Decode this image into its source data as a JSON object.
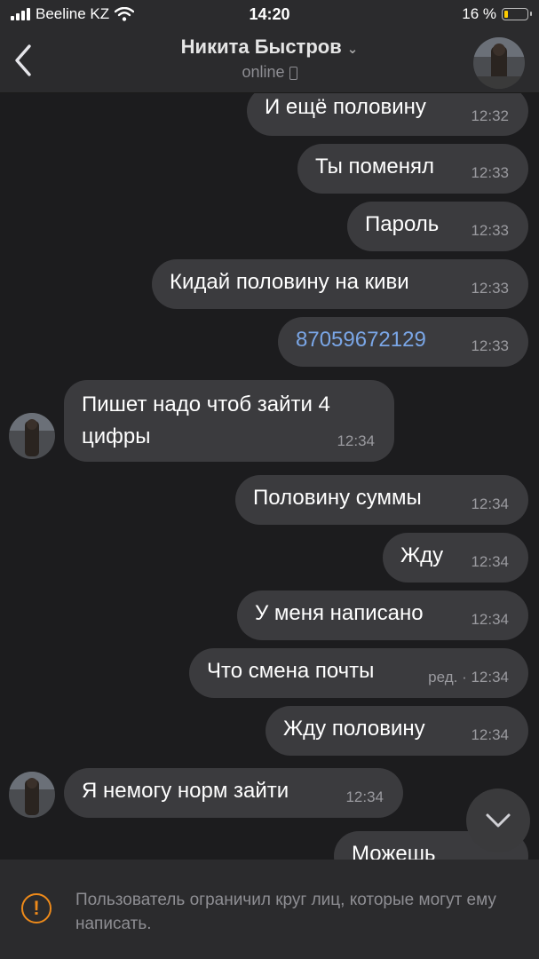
{
  "status_bar": {
    "carrier": "Beeline KZ",
    "time": "14:20",
    "battery_text": "16 %",
    "battery_level": 0.16
  },
  "header": {
    "contact_name": "Никита Быстров",
    "status": "online"
  },
  "messages": [
    {
      "text": "И ещё половину",
      "time": "12:32"
    },
    {
      "text": "Ты поменял",
      "time": "12:33"
    },
    {
      "text": "Пароль",
      "time": "12:33"
    },
    {
      "text": "Кидай половину на киви",
      "time": "12:33"
    },
    {
      "text": "87059672129",
      "time": "12:33"
    },
    {
      "text": "Пишет надо чтоб зайти 4 цифры",
      "time": "12:34"
    },
    {
      "text": "Половину суммы",
      "time": "12:34"
    },
    {
      "text": "Жду",
      "time": "12:34"
    },
    {
      "text": "У меня написано",
      "time": "12:34"
    },
    {
      "text": "Что смена почты",
      "time": "ред. · 12:34"
    },
    {
      "text": "Жду половину",
      "time": "12:34"
    },
    {
      "text": "Я немогу норм зайти",
      "time": "12:34"
    },
    {
      "text": "Можешь",
      "time": ""
    }
  ],
  "footer": {
    "notice": "Пользователь ограничил круг лиц, которые могут ему написать."
  }
}
